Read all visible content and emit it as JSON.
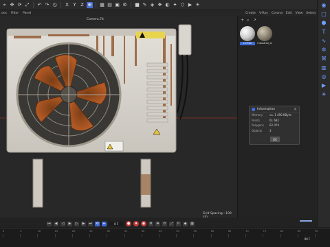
{
  "toolbar": {
    "icons": [
      "select-icon",
      "move-icon",
      "rotate-icon",
      "scale-icon",
      "undo-icon",
      "redo-icon",
      "history-icon",
      "axis-x-icon",
      "axis-y-icon",
      "axis-z-icon",
      "coordinate-icon",
      "model-mode-icon",
      "render-region-icon",
      "render-view-icon",
      "render-icon",
      "edit-render-icon",
      "cube-icon",
      "pen-icon",
      "subdivision-icon",
      "instance-icon",
      "deformer-icon",
      "effector-icon",
      "scene-icon",
      "camera-icon",
      "light-icon"
    ]
  },
  "menus": {
    "left": [
      "ons",
      "Filter",
      "Panel"
    ],
    "right": [
      "Create",
      "V-Ray",
      "Corona",
      "Edit",
      "View",
      "Select"
    ]
  },
  "viewport": {
    "camera_label": "Camera.74",
    "grid_spacing": "Grid Spacing : 100 cm"
  },
  "info_dialog": {
    "title": "Information",
    "rows": [
      {
        "key": "Memory",
        "value": "ca. 1 490 KByte"
      },
      {
        "key": "Points",
        "value": "61 682"
      },
      {
        "key": "Polygons",
        "value": "62 070"
      },
      {
        "key": "Objects",
        "value": "3"
      }
    ],
    "ok_label": "OK"
  },
  "materials": [
    {
      "name": "247Mat",
      "color": "#cfcfcf"
    },
    {
      "name": "industrial_ai",
      "color": "#8a8170"
    }
  ],
  "transport": {
    "frame_field": "0 F",
    "end_field": "90 F"
  },
  "ruler": {
    "ticks": [
      "0",
      "5",
      "10",
      "15",
      "20",
      "25",
      "30",
      "35",
      "40",
      "45",
      "50",
      "55",
      "60",
      "65",
      "70",
      "75",
      "80",
      "85",
      "90"
    ]
  },
  "colors": {
    "accent": "#3d6bd8",
    "record": "#c23b3b"
  }
}
